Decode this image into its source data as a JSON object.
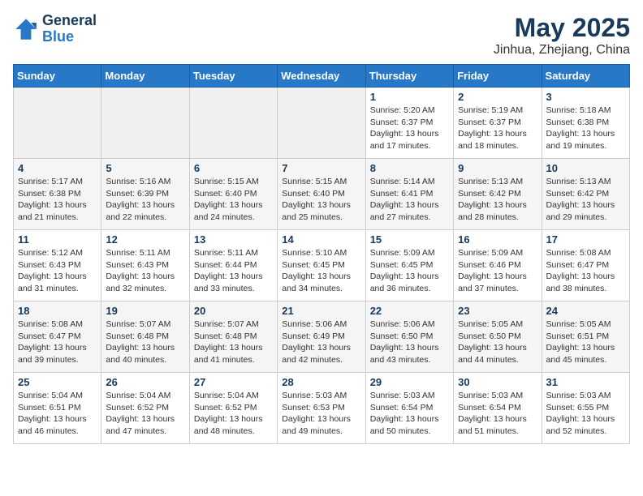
{
  "header": {
    "logo_line1": "General",
    "logo_line2": "Blue",
    "month_year": "May 2025",
    "location": "Jinhua, Zhejiang, China"
  },
  "weekdays": [
    "Sunday",
    "Monday",
    "Tuesday",
    "Wednesday",
    "Thursday",
    "Friday",
    "Saturday"
  ],
  "weeks": [
    [
      {
        "day": "",
        "info": ""
      },
      {
        "day": "",
        "info": ""
      },
      {
        "day": "",
        "info": ""
      },
      {
        "day": "",
        "info": ""
      },
      {
        "day": "1",
        "info": "Sunrise: 5:20 AM\nSunset: 6:37 PM\nDaylight: 13 hours\nand 17 minutes."
      },
      {
        "day": "2",
        "info": "Sunrise: 5:19 AM\nSunset: 6:37 PM\nDaylight: 13 hours\nand 18 minutes."
      },
      {
        "day": "3",
        "info": "Sunrise: 5:18 AM\nSunset: 6:38 PM\nDaylight: 13 hours\nand 19 minutes."
      }
    ],
    [
      {
        "day": "4",
        "info": "Sunrise: 5:17 AM\nSunset: 6:38 PM\nDaylight: 13 hours\nand 21 minutes."
      },
      {
        "day": "5",
        "info": "Sunrise: 5:16 AM\nSunset: 6:39 PM\nDaylight: 13 hours\nand 22 minutes."
      },
      {
        "day": "6",
        "info": "Sunrise: 5:15 AM\nSunset: 6:40 PM\nDaylight: 13 hours\nand 24 minutes."
      },
      {
        "day": "7",
        "info": "Sunrise: 5:15 AM\nSunset: 6:40 PM\nDaylight: 13 hours\nand 25 minutes."
      },
      {
        "day": "8",
        "info": "Sunrise: 5:14 AM\nSunset: 6:41 PM\nDaylight: 13 hours\nand 27 minutes."
      },
      {
        "day": "9",
        "info": "Sunrise: 5:13 AM\nSunset: 6:42 PM\nDaylight: 13 hours\nand 28 minutes."
      },
      {
        "day": "10",
        "info": "Sunrise: 5:13 AM\nSunset: 6:42 PM\nDaylight: 13 hours\nand 29 minutes."
      }
    ],
    [
      {
        "day": "11",
        "info": "Sunrise: 5:12 AM\nSunset: 6:43 PM\nDaylight: 13 hours\nand 31 minutes."
      },
      {
        "day": "12",
        "info": "Sunrise: 5:11 AM\nSunset: 6:43 PM\nDaylight: 13 hours\nand 32 minutes."
      },
      {
        "day": "13",
        "info": "Sunrise: 5:11 AM\nSunset: 6:44 PM\nDaylight: 13 hours\nand 33 minutes."
      },
      {
        "day": "14",
        "info": "Sunrise: 5:10 AM\nSunset: 6:45 PM\nDaylight: 13 hours\nand 34 minutes."
      },
      {
        "day": "15",
        "info": "Sunrise: 5:09 AM\nSunset: 6:45 PM\nDaylight: 13 hours\nand 36 minutes."
      },
      {
        "day": "16",
        "info": "Sunrise: 5:09 AM\nSunset: 6:46 PM\nDaylight: 13 hours\nand 37 minutes."
      },
      {
        "day": "17",
        "info": "Sunrise: 5:08 AM\nSunset: 6:47 PM\nDaylight: 13 hours\nand 38 minutes."
      }
    ],
    [
      {
        "day": "18",
        "info": "Sunrise: 5:08 AM\nSunset: 6:47 PM\nDaylight: 13 hours\nand 39 minutes."
      },
      {
        "day": "19",
        "info": "Sunrise: 5:07 AM\nSunset: 6:48 PM\nDaylight: 13 hours\nand 40 minutes."
      },
      {
        "day": "20",
        "info": "Sunrise: 5:07 AM\nSunset: 6:48 PM\nDaylight: 13 hours\nand 41 minutes."
      },
      {
        "day": "21",
        "info": "Sunrise: 5:06 AM\nSunset: 6:49 PM\nDaylight: 13 hours\nand 42 minutes."
      },
      {
        "day": "22",
        "info": "Sunrise: 5:06 AM\nSunset: 6:50 PM\nDaylight: 13 hours\nand 43 minutes."
      },
      {
        "day": "23",
        "info": "Sunrise: 5:05 AM\nSunset: 6:50 PM\nDaylight: 13 hours\nand 44 minutes."
      },
      {
        "day": "24",
        "info": "Sunrise: 5:05 AM\nSunset: 6:51 PM\nDaylight: 13 hours\nand 45 minutes."
      }
    ],
    [
      {
        "day": "25",
        "info": "Sunrise: 5:04 AM\nSunset: 6:51 PM\nDaylight: 13 hours\nand 46 minutes."
      },
      {
        "day": "26",
        "info": "Sunrise: 5:04 AM\nSunset: 6:52 PM\nDaylight: 13 hours\nand 47 minutes."
      },
      {
        "day": "27",
        "info": "Sunrise: 5:04 AM\nSunset: 6:52 PM\nDaylight: 13 hours\nand 48 minutes."
      },
      {
        "day": "28",
        "info": "Sunrise: 5:03 AM\nSunset: 6:53 PM\nDaylight: 13 hours\nand 49 minutes."
      },
      {
        "day": "29",
        "info": "Sunrise: 5:03 AM\nSunset: 6:54 PM\nDaylight: 13 hours\nand 50 minutes."
      },
      {
        "day": "30",
        "info": "Sunrise: 5:03 AM\nSunset: 6:54 PM\nDaylight: 13 hours\nand 51 minutes."
      },
      {
        "day": "31",
        "info": "Sunrise: 5:03 AM\nSunset: 6:55 PM\nDaylight: 13 hours\nand 52 minutes."
      }
    ]
  ]
}
